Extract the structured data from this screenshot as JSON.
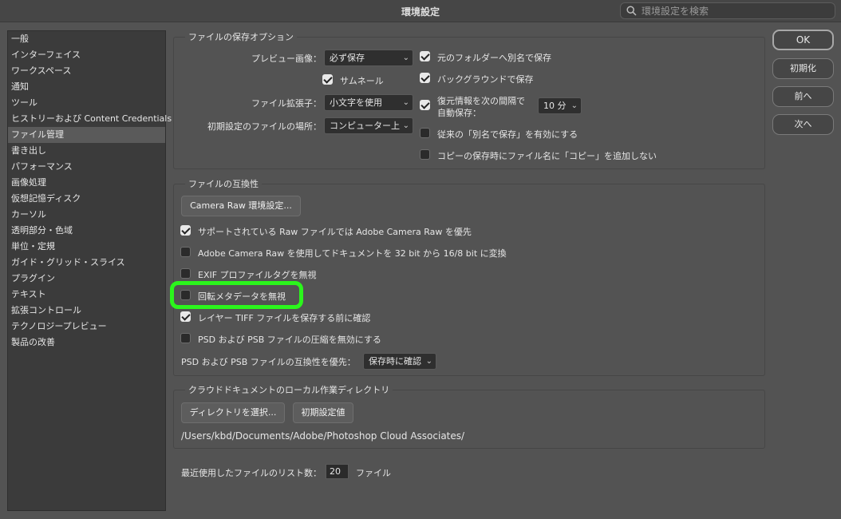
{
  "window": {
    "title": "環境設定"
  },
  "search": {
    "placeholder": "環境設定を検索"
  },
  "sidebar": {
    "items": [
      "一般",
      "インターフェイス",
      "ワークスペース",
      "通知",
      "ツール",
      "ヒストリーおよび Content Credentials",
      "ファイル管理",
      "書き出し",
      "パフォーマンス",
      "画像処理",
      "仮想記憶ディスク",
      "カーソル",
      "透明部分・色域",
      "単位・定規",
      "ガイド・グリッド・スライス",
      "プラグイン",
      "テキスト",
      "拡張コントロール",
      "テクノロジープレビュー",
      "製品の改善"
    ],
    "selected": "ファイル管理"
  },
  "save_options": {
    "legend": "ファイルの保存オプション",
    "preview_label": "プレビュー画像：",
    "preview_value": "必ず保存",
    "thumbnail_label": "サムネール",
    "thumbnail_checked": true,
    "ext_label": "ファイル拡張子：",
    "ext_value": "小文字を使用",
    "default_loc_label": "初期設定のファイルの場所：",
    "default_loc_value": "コンピューター上",
    "save_as_original": "元のフォルダーへ別名で保存",
    "save_as_original_checked": true,
    "background_save": "バックグラウンドで保存",
    "background_save_checked": true,
    "autosave_line1": "復元情報を次の間隔で",
    "autosave_line2": "自動保存：",
    "autosave_checked": true,
    "autosave_value": "10 分",
    "legacy_save_as": "従来の「別名で保存」を有効にする",
    "legacy_save_as_checked": false,
    "copy_suffix": "コピーの保存時にファイル名に「コピー」を追加しない",
    "copy_suffix_checked": false
  },
  "compatibility": {
    "legend": "ファイルの互換性",
    "camera_raw_button": "Camera Raw 環境設定...",
    "prefer_acr": "サポートされている Raw ファイルでは Adobe Camera Raw を優先",
    "prefer_acr_checked": true,
    "convert_bit": "Adobe Camera Raw を使用してドキュメントを 32 bit から 16/8 bit に変換",
    "convert_bit_checked": false,
    "ignore_exif": "EXIF プロファイルタグを無視",
    "ignore_exif_checked": false,
    "ignore_rotation": "回転メタデータを無視",
    "ignore_rotation_checked": false,
    "ask_tiff": "レイヤー TIFF ファイルを保存する前に確認",
    "ask_tiff_checked": true,
    "disable_psd_compression": "PSD および PSB ファイルの圧縮を無効にする",
    "disable_psd_compression_checked": false,
    "maximize_label": "PSD および PSB ファイルの互換性を優先：",
    "maximize_value": "保存時に確認"
  },
  "cloud": {
    "legend": "クラウドドキュメントのローカル作業ディレクトリ",
    "choose_button": "ディレクトリを選択...",
    "default_button": "初期設定値",
    "path": "/Users/kbd/Documents/Adobe/Photoshop Cloud Associates/"
  },
  "recent": {
    "label": "最近使用したファイルのリスト数：",
    "value": "20",
    "unit": "ファイル"
  },
  "buttons": {
    "ok": "OK",
    "reset": "初期化",
    "prev": "前へ",
    "next": "次へ"
  },
  "colors": {
    "highlight": "#2bf51c",
    "background": "#535353"
  }
}
